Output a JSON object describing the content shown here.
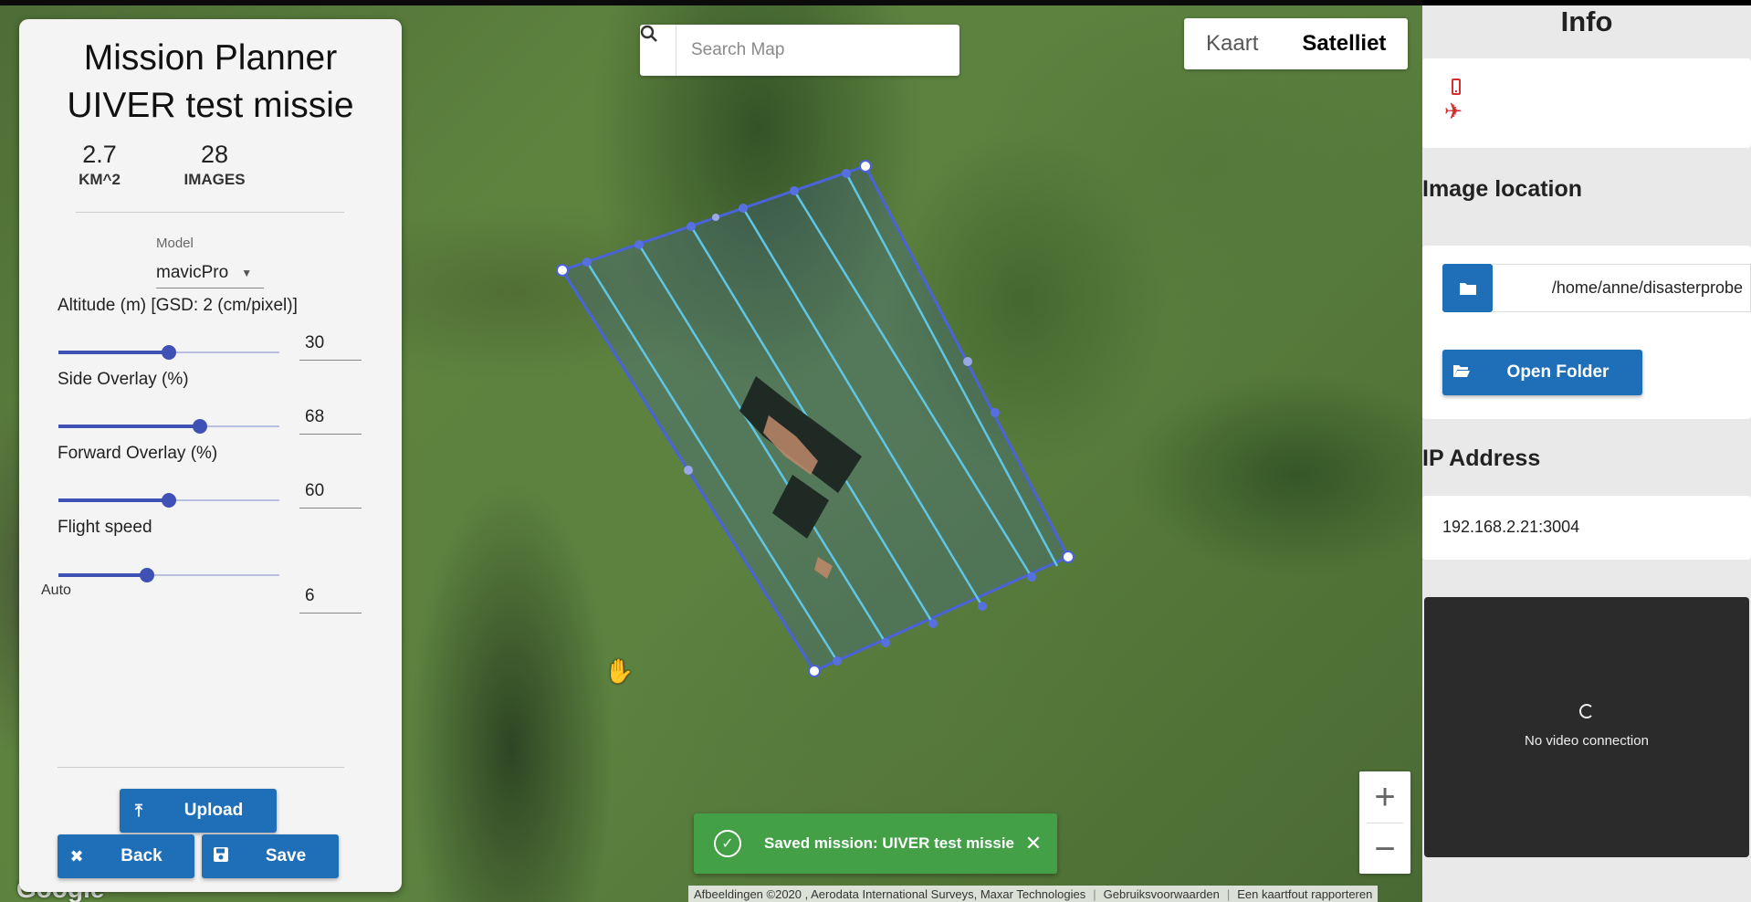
{
  "map": {
    "search_placeholder": "Search Map",
    "map_types": [
      "Kaart",
      "Satelliet"
    ],
    "active_map_type": "Satelliet",
    "zoom_in": "+",
    "zoom_out": "−",
    "attribution": {
      "imagery": "Afbeeldingen ©2020 , Aerodata International Surveys, Maxar Technologies",
      "terms": "Gebruiksvoorwaarden",
      "report": "Een kaartfout rapporteren"
    },
    "logo": "Google",
    "toast": {
      "message": "Saved mission: UIVER test missie",
      "close": "✕",
      "color": "#43a047"
    }
  },
  "planner": {
    "title": "Mission Planner",
    "mission_name": "UIVER test missie",
    "stats": [
      {
        "value": "2.7",
        "unit": "KM^2"
      },
      {
        "value": "28",
        "unit": "IMAGES"
      }
    ],
    "model": {
      "label": "Model",
      "value": "mavicPro"
    },
    "params": [
      {
        "label": "Altitude (m) [GSD: 2 (cm/pixel)]",
        "value": "30",
        "slider_fraction": 0.5
      },
      {
        "label": "Side Overlay (%)",
        "value": "68",
        "slider_fraction": 0.64
      },
      {
        "label": "Forward Overlay (%)",
        "value": "60",
        "slider_fraction": 0.5
      },
      {
        "label": "Flight speed",
        "value": "6",
        "slider_fraction": 0.4
      }
    ],
    "auto_label": "Auto",
    "buttons": {
      "upload": "Upload",
      "back": "Back",
      "save": "Save"
    },
    "accent_color": "#3f51b5",
    "button_color": "#1e6fb8"
  },
  "info": {
    "title": "Info",
    "image_location_heading": "Image location",
    "image_path": "/home/anne/disasterprobe",
    "open_folder": "Open Folder",
    "ip_heading": "IP Address",
    "ip": "192.168.2.21:3004",
    "video_status": "No video connection",
    "status_icon_color": "#d32f2f"
  }
}
